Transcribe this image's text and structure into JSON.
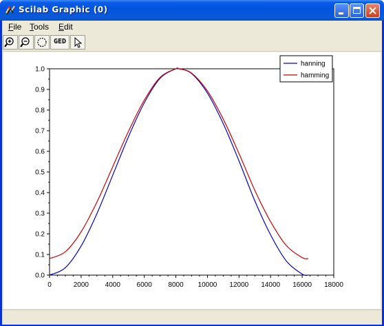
{
  "window": {
    "title": "Scilab Graphic (0)",
    "colors": {
      "titlebar": "#0a5ce8",
      "close_button": "#c8401f",
      "face": "#ece9d8"
    }
  },
  "menu": {
    "file": "File",
    "tools": "Tools",
    "edit": "Edit"
  },
  "toolbar": {
    "zoom_in_icon": "zoom-in-icon",
    "zoom_out_icon": "zoom-out-icon",
    "rotate_icon": "rotate-icon",
    "ged_label": "GED",
    "pointer_icon": "pointer-icon"
  },
  "statusbar": {
    "text": ""
  },
  "chart_data": {
    "type": "line",
    "title": "",
    "xlabel": "",
    "ylabel": "",
    "xlim": [
      0,
      18000
    ],
    "ylim": [
      0,
      1
    ],
    "x_ticks": [
      "0",
      "2000",
      "4000",
      "6000",
      "8000",
      "10000",
      "12000",
      "14000",
      "16000",
      "18000"
    ],
    "y_ticks": [
      "0.0",
      "0.1",
      "0.2",
      "0.3",
      "0.4",
      "0.5",
      "0.6",
      "0.7",
      "0.8",
      "0.9",
      "1.0"
    ],
    "grid": false,
    "legend_position": "top-right",
    "series": [
      {
        "name": "hanning",
        "color": "#0000cc",
        "x": [
          0,
          1000,
          2000,
          3000,
          4000,
          5000,
          6000,
          7000,
          8000,
          8192,
          9000,
          10000,
          11000,
          12000,
          13000,
          14000,
          15000,
          16000,
          16384
        ],
        "y": [
          0.0,
          0.036,
          0.141,
          0.298,
          0.484,
          0.671,
          0.835,
          0.954,
          1.0,
          1.0,
          0.977,
          0.882,
          0.734,
          0.553,
          0.36,
          0.195,
          0.068,
          0.005,
          0.0
        ]
      },
      {
        "name": "hamming",
        "color": "#cc0000",
        "x": [
          0,
          1000,
          2000,
          3000,
          4000,
          5000,
          6000,
          7000,
          8000,
          8192,
          9000,
          10000,
          11000,
          12000,
          13000,
          14000,
          15000,
          16000,
          16384
        ],
        "y": [
          0.08,
          0.113,
          0.21,
          0.354,
          0.525,
          0.697,
          0.848,
          0.958,
          1.0,
          1.0,
          0.979,
          0.892,
          0.756,
          0.589,
          0.411,
          0.259,
          0.143,
          0.085,
          0.08
        ]
      }
    ]
  }
}
